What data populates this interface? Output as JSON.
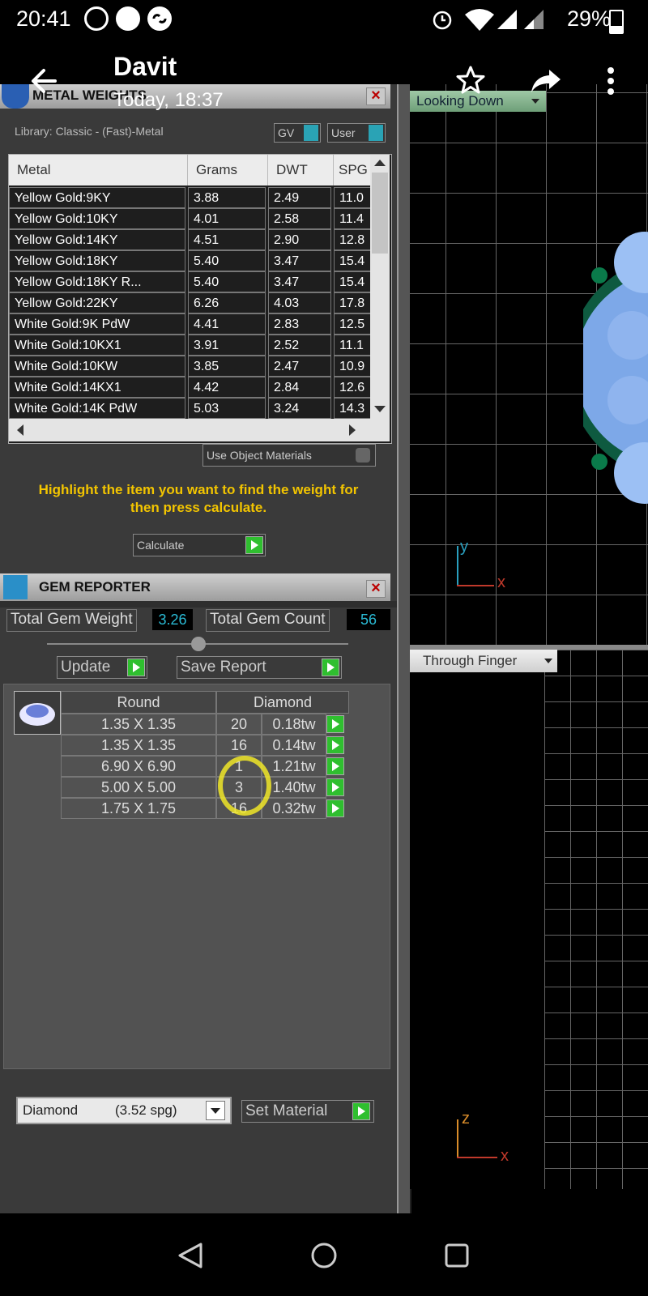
{
  "status": {
    "time": "20:41",
    "battery": "29%"
  },
  "header": {
    "contact": "Davit",
    "last_seen": "Today, 18:37"
  },
  "metal_weights": {
    "title": "METAL WEIGHTS",
    "library": "Library: Classic - (Fast)-Metal",
    "toggle1": "GV",
    "toggle2": "User",
    "columns": [
      "Metal",
      "Grams",
      "DWT",
      "SPG"
    ],
    "rows": [
      [
        "Yellow Gold:9KY",
        "3.88",
        "2.49",
        "11.0"
      ],
      [
        "Yellow Gold:10KY",
        "4.01",
        "2.58",
        "11.4"
      ],
      [
        "Yellow Gold:14KY",
        "4.51",
        "2.90",
        "12.8"
      ],
      [
        "Yellow Gold:18KY",
        "5.40",
        "3.47",
        "15.4"
      ],
      [
        "Yellow Gold:18KY R...",
        "5.40",
        "3.47",
        "15.4"
      ],
      [
        "Yellow Gold:22KY",
        "6.26",
        "4.03",
        "17.8"
      ],
      [
        "White Gold:9K PdW",
        "4.41",
        "2.83",
        "12.5"
      ],
      [
        "White Gold:10KX1",
        "3.91",
        "2.52",
        "11.1"
      ],
      [
        "White Gold:10KW",
        "3.85",
        "2.47",
        "10.9"
      ],
      [
        "White Gold:14KX1",
        "4.42",
        "2.84",
        "12.6"
      ],
      [
        "White Gold:14K PdW",
        "5.03",
        "3.24",
        "14.3"
      ]
    ],
    "use_object_materials": "Use Object Materials",
    "hint": "Highlight the item you want to find the weight for then press calculate.",
    "calculate": "Calculate"
  },
  "gem_reporter": {
    "title": "GEM REPORTER",
    "total_weight_label": "Total Gem Weight",
    "total_weight": "3.26",
    "total_count_label": "Total Gem Count",
    "total_count": "56",
    "update": "Update",
    "save_report": "Save Report",
    "headers": [
      "Round",
      "Diamond"
    ],
    "rows": [
      [
        "1.35 X 1.35",
        "20",
        "0.18tw"
      ],
      [
        "1.35 X 1.35",
        "16",
        "0.14tw"
      ],
      [
        "6.90 X 6.90",
        "1",
        "1.21tw"
      ],
      [
        "5.00 X 5.00",
        "3",
        "1.40tw"
      ],
      [
        "1.75 X 1.75",
        "16",
        "0.32tw"
      ]
    ],
    "material": "Diamond",
    "material_spg": "(3.52 spg)",
    "set_material": "Set Material"
  },
  "viewports": {
    "top_label": "Looking Down",
    "bottom_label": "Through Finger",
    "axis_y": "y",
    "axis_x": "x",
    "axis_z": "z",
    "axis_x2": "x"
  },
  "colors": {
    "hint": "#f3c500",
    "button": "#2fbf2f",
    "accent": "#2aa3b5"
  }
}
